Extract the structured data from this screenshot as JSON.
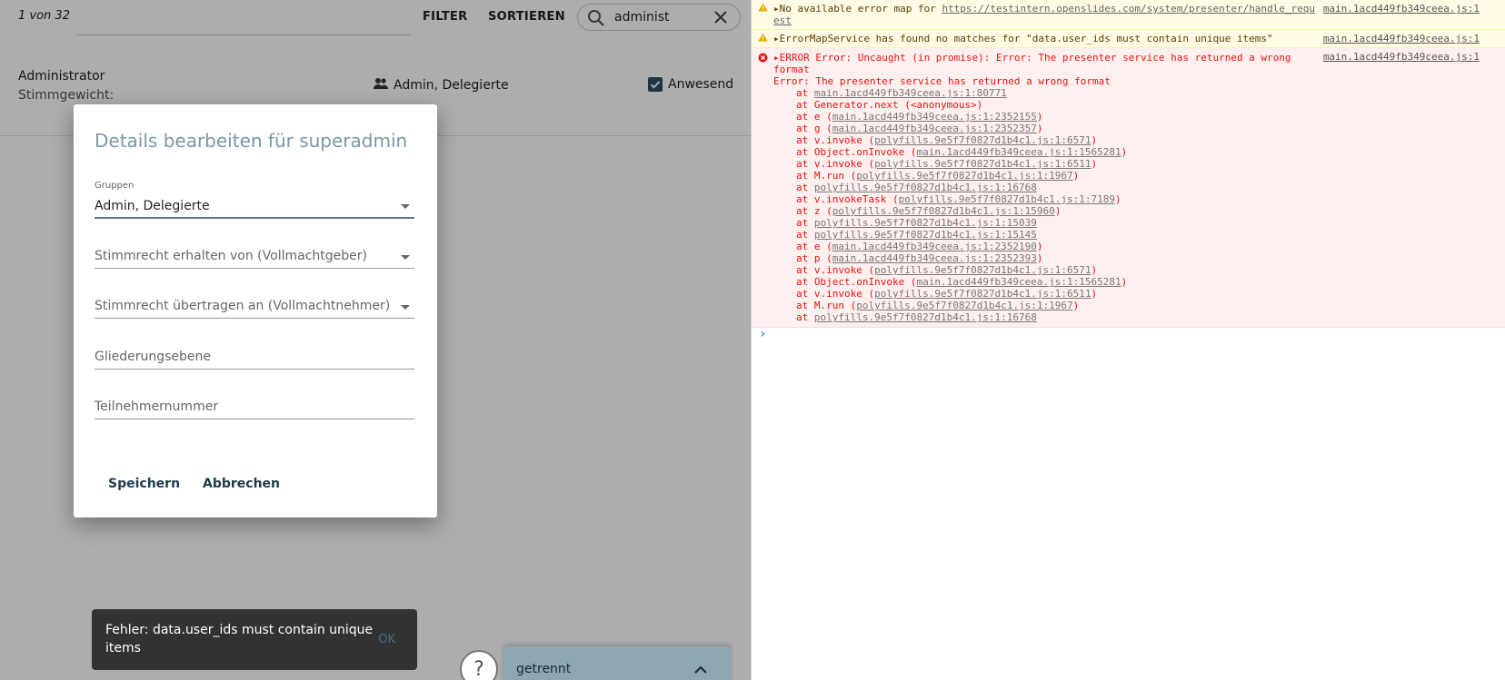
{
  "app": {
    "counter": "1 von 32",
    "toolbar": {
      "filter": "FILTER",
      "sort": "SORTIEREN",
      "search_value": "administ"
    },
    "participant": {
      "name": "Administrator",
      "weight_label": "Stimmgewicht:",
      "groups": "Admin, Delegierte",
      "present_label": "Anwesend"
    },
    "dialog": {
      "title": "Details bearbeiten für superadmin",
      "groups_label": "Gruppen",
      "groups_value": "Admin, Delegierte",
      "vote_from_placeholder": "Stimmrecht erhalten von (Vollmachtgeber)",
      "vote_to_placeholder": "Stimmrecht übertragen an (Vollmachtnehmer)",
      "structure_placeholder": "Gliederungsebene",
      "number_placeholder": "Teilnehmernummer",
      "save_label": "Speichern",
      "cancel_label": "Abbrechen"
    },
    "snackbar": {
      "message": "Fehler: data.user_ids must contain unique items",
      "action": "OK"
    },
    "help_icon": "?",
    "connection_status": "getrennt"
  },
  "console": {
    "warnings": [
      {
        "prefix": "No available error map for ",
        "link": "https://testintern.openslides.com/system/presenter/handle_requ",
        "cont": "est",
        "source": "main.1acd449fb349ceea.js:1"
      },
      {
        "text": "ErrorMapService has found no matches for \"data.user_ids must contain unique items\"",
        "source": "main.1acd449fb349ceea.js:1"
      }
    ],
    "error": {
      "headline": "ERROR Error: Uncaught (in promise): Error: The presenter service has returned a wrong",
      "headline_cont": "format",
      "source": "main.1acd449fb349ceea.js:1",
      "message": "Error: The presenter service has returned a wrong format",
      "trace": [
        {
          "fn": "",
          "loc": "main.1acd449fb349ceea.js:1:80771"
        },
        {
          "fn": "Generator.next (<anonymous>)",
          "loc": ""
        },
        {
          "fn": "e",
          "loc": "main.1acd449fb349ceea.js:1:2352155"
        },
        {
          "fn": "g",
          "loc": "main.1acd449fb349ceea.js:1:2352357"
        },
        {
          "fn": "v.invoke",
          "loc": "polyfills.9e5f7f0827d1b4c1.js:1:6571"
        },
        {
          "fn": "Object.onInvoke",
          "loc": "main.1acd449fb349ceea.js:1:1565281"
        },
        {
          "fn": "v.invoke",
          "loc": "polyfills.9e5f7f0827d1b4c1.js:1:6511"
        },
        {
          "fn": "M.run",
          "loc": "polyfills.9e5f7f0827d1b4c1.js:1:1967"
        },
        {
          "fn": "",
          "loc": "polyfills.9e5f7f0827d1b4c1.js:1:16768"
        },
        {
          "fn": "v.invokeTask",
          "loc": "polyfills.9e5f7f0827d1b4c1.js:1:7189"
        },
        {
          "fn": "z",
          "loc": "polyfills.9e5f7f0827d1b4c1.js:1:15960"
        },
        {
          "fn": "",
          "loc": "polyfills.9e5f7f0827d1b4c1.js:1:15039"
        },
        {
          "fn": "",
          "loc": "polyfills.9e5f7f0827d1b4c1.js:1:15145"
        },
        {
          "fn": "e",
          "loc": "main.1acd449fb349ceea.js:1:2352190"
        },
        {
          "fn": "p",
          "loc": "main.1acd449fb349ceea.js:1:2352393"
        },
        {
          "fn": "v.invoke",
          "loc": "polyfills.9e5f7f0827d1b4c1.js:1:6571"
        },
        {
          "fn": "Object.onInvoke",
          "loc": "main.1acd449fb349ceea.js:1:1565281"
        },
        {
          "fn": "v.invoke",
          "loc": "polyfills.9e5f7f0827d1b4c1.js:1:6511"
        },
        {
          "fn": "M.run",
          "loc": "polyfills.9e5f7f0827d1b4c1.js:1:1967"
        },
        {
          "fn": "",
          "loc": "polyfills.9e5f7f0827d1b4c1.js:1:16768"
        }
      ]
    },
    "prompt_glyph": "›"
  },
  "colors": {
    "accent": "#2e4e66",
    "dialog_title": "#7b97a6",
    "status_bar": "#8fa6b3",
    "error_text": "#ee1111",
    "warn_bg": "#fffbe5",
    "error_bg": "#fff0f0"
  }
}
